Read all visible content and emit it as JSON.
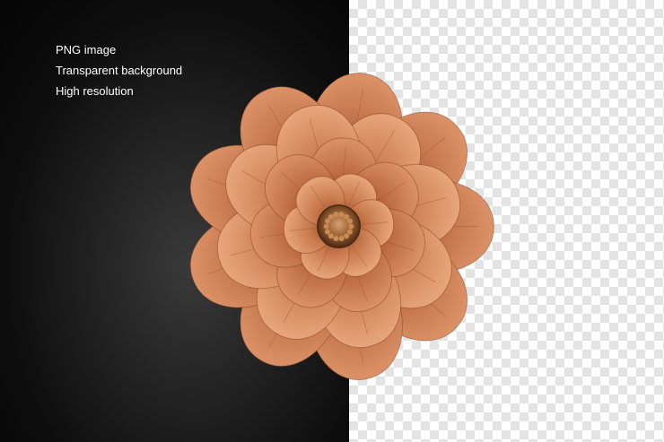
{
  "caption": {
    "line1": "PNG image",
    "line2": "Transparent background",
    "line3": "High resolution"
  },
  "colors": {
    "dark_background": "#0d0d0d",
    "checker_light": "#ffffff",
    "checker_dark": "#e3e3e3",
    "petal": "#c9784c",
    "petal_shadow": "#8e4a2a",
    "petal_highlight": "#e8a67c",
    "center": "#7a4a22"
  },
  "image": {
    "subject": "flower-icon"
  }
}
